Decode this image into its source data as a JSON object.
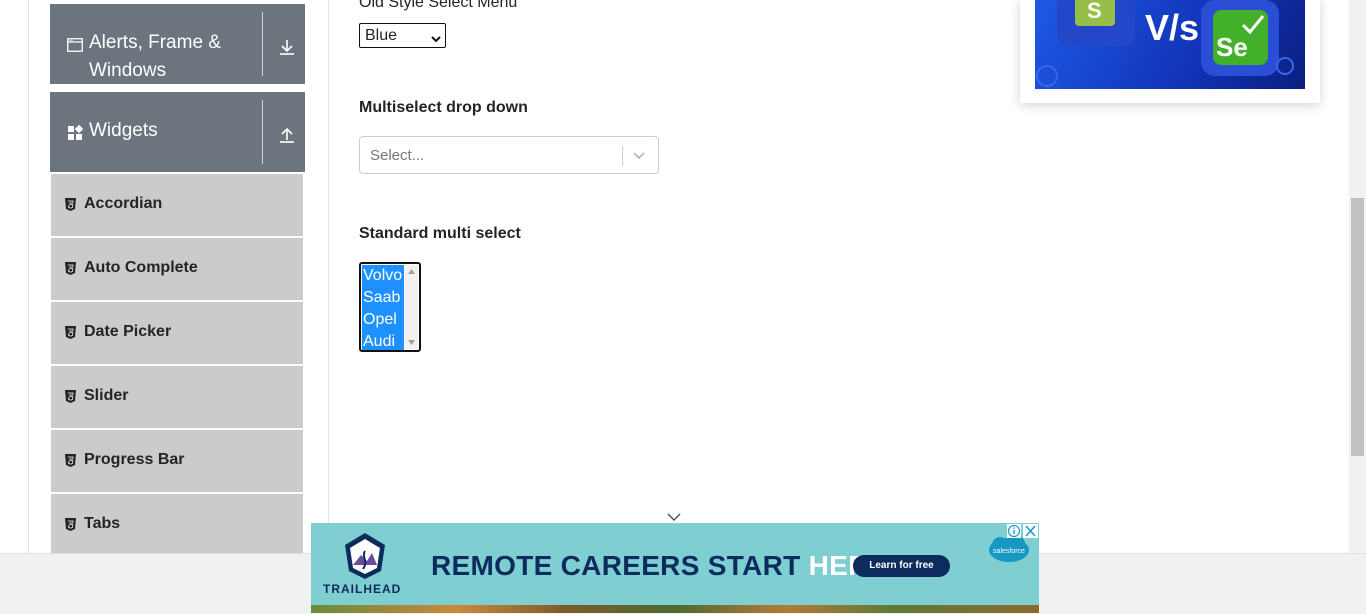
{
  "sidebar": {
    "groups": [
      {
        "label": "Alerts, Frame & Windows",
        "icon": "window-icon",
        "toggle_icon": "arrow-down-icon"
      },
      {
        "label": "Widgets",
        "icon": "widgets-icon",
        "toggle_icon": "arrow-up-icon"
      }
    ],
    "items": [
      {
        "label": "Accordian",
        "icon": "html5-icon"
      },
      {
        "label": "Auto Complete",
        "icon": "html5-icon"
      },
      {
        "label": "Date Picker",
        "icon": "html5-icon"
      },
      {
        "label": "Slider",
        "icon": "html5-icon"
      },
      {
        "label": "Progress Bar",
        "icon": "html5-icon"
      },
      {
        "label": "Tabs",
        "icon": "html5-icon"
      }
    ]
  },
  "main": {
    "old_select": {
      "label": "Old Style Select Menu",
      "value": "Blue"
    },
    "multiselect_dropdown": {
      "label": "Multiselect drop down",
      "placeholder": "Select..."
    },
    "standard_multi": {
      "label": "Standard multi select",
      "options": [
        "Volvo",
        "Saab",
        "Opel",
        "Audi"
      ]
    }
  },
  "ad_top": {
    "text_vs": "V/s",
    "icons": [
      "shopify-icon",
      "selenium-icon"
    ]
  },
  "ad_bottom": {
    "brand": "TRAILHEAD",
    "headline_main": "REMOTE CAREERS START ",
    "headline_highlight": "HERE.",
    "cta": "Learn for free",
    "sponsor": "salesforce"
  },
  "colors": {
    "sidebar_group_bg": "#6c757d",
    "sidebar_item_bg": "#cbcbcb",
    "selected_option_bg": "#1e90ff",
    "banner_bg": "#7fcfd2",
    "banner_text": "#0d2b5c"
  }
}
